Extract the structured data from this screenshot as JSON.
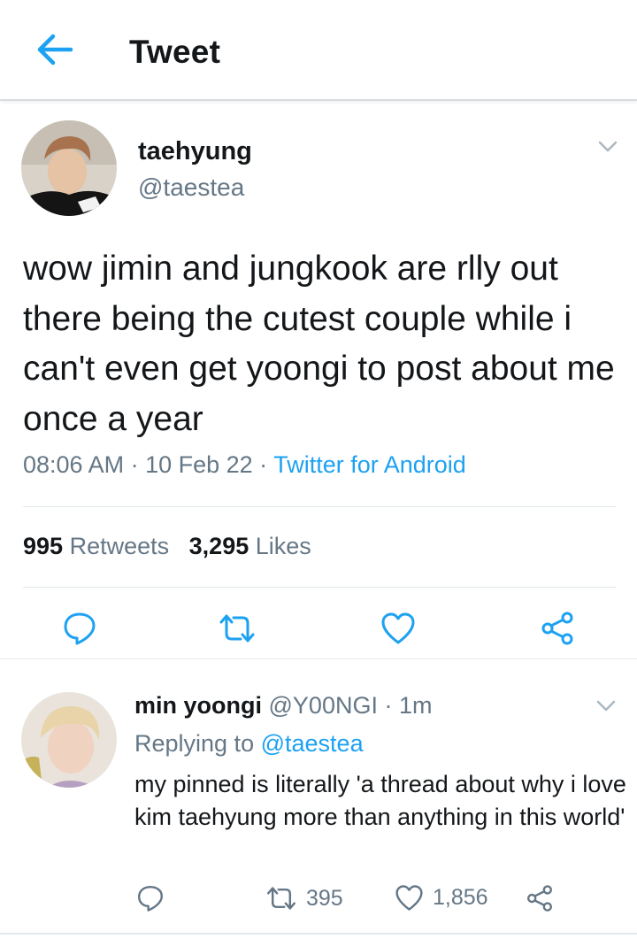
{
  "header": {
    "title": "Tweet"
  },
  "main_tweet": {
    "author_name": "taehyung",
    "author_handle": "@taestea",
    "text": "wow jimin and jungkook are rlly out there being the cutest couple while i can't even get yoongi to post about me once a year",
    "time": "08:06 AM",
    "date": "10 Feb 22",
    "separator": " · ",
    "source": "Twitter for Android",
    "retweets_count": "995",
    "retweets_label": "Retweets",
    "likes_count": "3,295",
    "likes_label": "Likes"
  },
  "reply": {
    "author_name": "min yoongi",
    "author_handle": "@Y00NGI",
    "time_sep": " · ",
    "time": "1m",
    "replying_prefix": "Replying to",
    "replying_to": "@taestea",
    "text": "my pinned is literally 'a thread about why i love kim taehyung more than anything in this world'",
    "retweets": "395",
    "likes": "1,856"
  },
  "colors": {
    "accent": "#1da1f2",
    "secondary_text": "#657786",
    "primary_text": "#14171a",
    "divider": "#e1e8ed"
  },
  "icons": [
    "back-arrow-icon",
    "chevron-down-icon",
    "reply-icon",
    "retweet-icon",
    "like-icon",
    "share-icon"
  ]
}
